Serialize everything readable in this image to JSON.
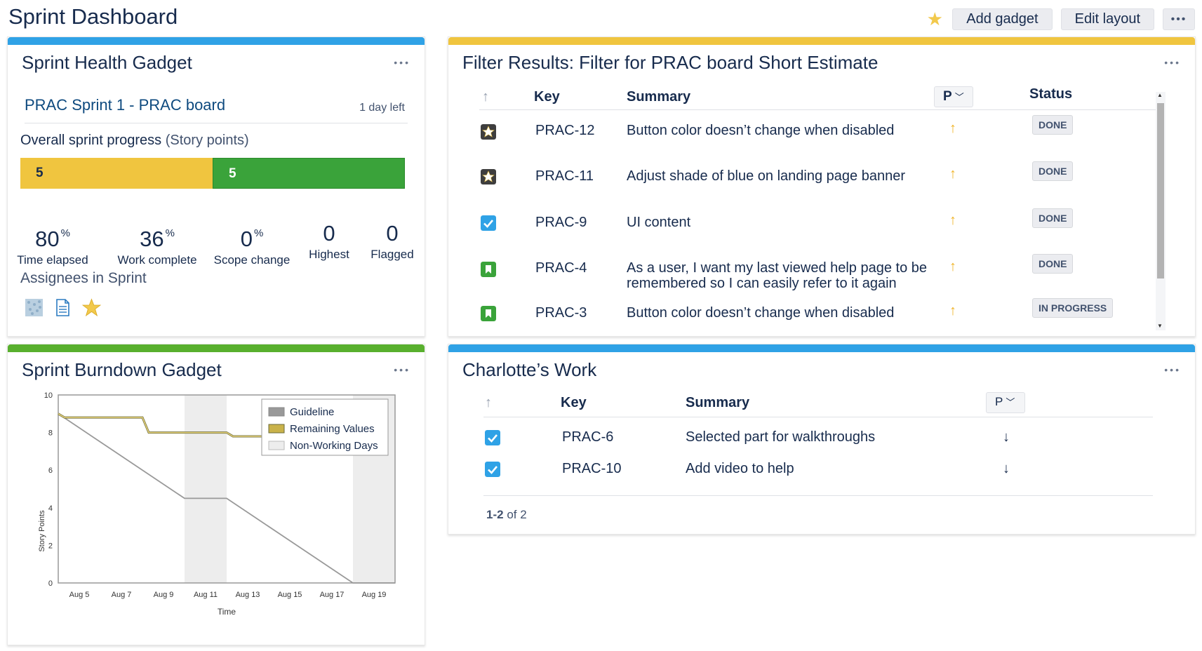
{
  "page": {
    "title": "Sprint Dashboard"
  },
  "toolbar": {
    "add_gadget": "Add gadget",
    "edit_layout": "Edit layout",
    "more": "•••",
    "star_icon": "star-icon"
  },
  "colors": {
    "blue": "#2fa2e6",
    "yellow": "#f0c53f",
    "green": "#59b02e",
    "done_green": "#3aa33a"
  },
  "sprint_health": {
    "title": "Sprint Health Gadget",
    "menu": "•••",
    "sprint_name": "PRAC Sprint 1 - PRAC board",
    "days_left": "1 day left",
    "progress_label": "Overall sprint progress",
    "progress_unit": "(Story points)",
    "progress": [
      {
        "value": "5",
        "status": "in progress"
      },
      {
        "value": "5",
        "status": "done"
      }
    ],
    "stats": [
      {
        "value": "80",
        "unit": "%",
        "label": "Time elapsed"
      },
      {
        "value": "36",
        "unit": "%",
        "label": "Work complete"
      },
      {
        "value": "0",
        "unit": "%",
        "label": "Scope change"
      },
      {
        "value": "0",
        "unit": "",
        "label": "Highest"
      },
      {
        "value": "0",
        "unit": "",
        "label": "Flagged"
      }
    ],
    "assignees_title": "Assignees in Sprint",
    "assignees": [
      "pattern-avatar",
      "document-avatar",
      "star-avatar"
    ]
  },
  "filter_results": {
    "title": "Filter Results: Filter for PRAC board Short Estimate",
    "menu": "•••",
    "columns": {
      "key": "Key",
      "summary": "Summary",
      "priority": "P",
      "status": "Status"
    },
    "rows": [
      {
        "icon": "epic-icon",
        "key": "PRAC-12",
        "summary": "Button color doesn’t change when disabled",
        "priority": "up-arrow-icon",
        "status": "DONE"
      },
      {
        "icon": "epic-icon",
        "key": "PRAC-11",
        "summary": "Adjust shade of blue on landing page banner",
        "priority": "up-arrow-icon",
        "status": "DONE"
      },
      {
        "icon": "task-icon",
        "key": "PRAC-9",
        "summary": "UI content",
        "priority": "up-arrow-icon",
        "status": "DONE"
      },
      {
        "icon": "story-icon",
        "key": "PRAC-4",
        "summary": "As a user, I want my last viewed help page to be",
        "summary2": "remembered so I can easily refer to it again",
        "priority": "up-arrow-icon",
        "status": "DONE"
      },
      {
        "icon": "story-icon",
        "key": "PRAC-3",
        "summary": "Button color doesn’t change when disabled",
        "priority": "up-arrow-icon",
        "status": "IN PROGRESS"
      }
    ]
  },
  "burndown": {
    "title": "Sprint Burndown Gadget",
    "menu": "•••"
  },
  "chart_data": {
    "type": "line",
    "xlabel": "Time",
    "ylabel": "Story Points",
    "ylim": [
      0,
      10
    ],
    "yticks": [
      "0",
      "2",
      "4",
      "6",
      "8",
      "10"
    ],
    "xticks": [
      "Aug 5",
      "Aug 7",
      "Aug 9",
      "Aug 11",
      "Aug 13",
      "Aug 15",
      "Aug 17",
      "Aug 19"
    ],
    "xlim": [
      "Aug 4",
      "Aug 20"
    ],
    "legend": {
      "position": "top-right",
      "items": [
        "Guideline",
        "Remaining Values",
        "Non-Working Days"
      ]
    },
    "non_working_days": [
      [
        "Aug 10",
        "Aug 12"
      ],
      [
        "Aug 18",
        "Aug 20"
      ]
    ],
    "series": [
      {
        "name": "Guideline",
        "color": "#999999",
        "x": [
          "Aug 4",
          "Aug 10",
          "Aug 12",
          "Aug 18",
          "Aug 20"
        ],
        "y": [
          9.0,
          4.5,
          4.5,
          0,
          0
        ]
      },
      {
        "name": "Remaining Values",
        "color": "#b8a84a",
        "x": [
          "Aug 4",
          "Aug 4.3",
          "Aug 8",
          "Aug 8.3",
          "Aug 12",
          "Aug 12.3",
          "Aug 15",
          "Aug 16"
        ],
        "y": [
          9.0,
          8.8,
          8.8,
          8.0,
          8.0,
          7.8,
          7.8,
          7.8
        ]
      }
    ]
  },
  "charlotte": {
    "title": "Charlotte’s Work",
    "menu": "•••",
    "columns": {
      "key": "Key",
      "summary": "Summary",
      "priority": "P"
    },
    "rows": [
      {
        "icon": "task-icon",
        "key": "PRAC-6",
        "summary": "Selected part for walkthroughs",
        "priority": "down-arrow-icon"
      },
      {
        "icon": "task-icon",
        "key": "PRAC-10",
        "summary": "Add video to help",
        "priority": "down-arrow-icon"
      }
    ],
    "pagination": {
      "range": "1-2",
      "of": "of 2"
    }
  }
}
